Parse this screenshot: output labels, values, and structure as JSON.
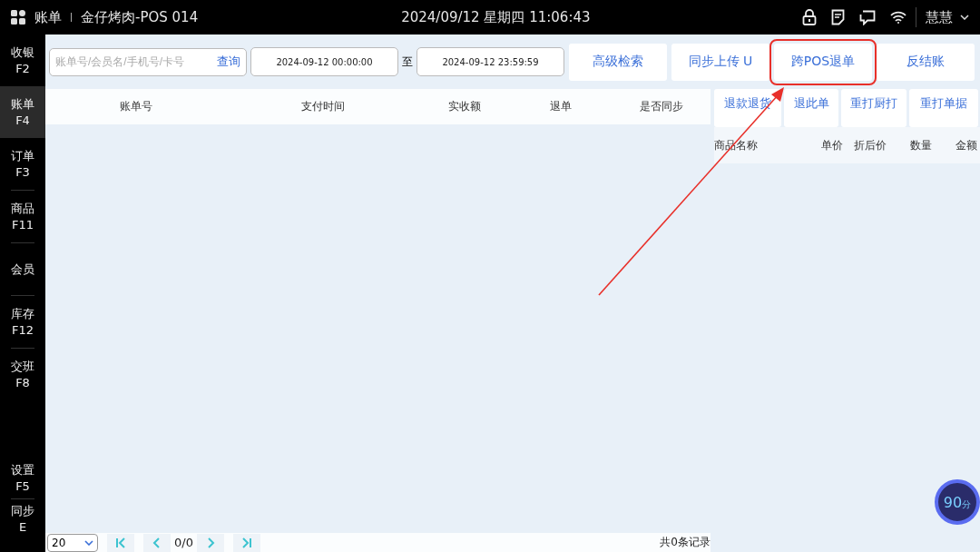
{
  "top_bar": {
    "section": "账单",
    "store": "金仔烤肉-POS 014",
    "datetime": "2024/09/12 星期四 11:06:43",
    "user": "慧慧"
  },
  "sidebar": {
    "items": [
      {
        "label": "收银",
        "key": "F2",
        "selected": false
      },
      {
        "label": "账单",
        "key": "F4",
        "selected": true
      },
      {
        "label": "订单",
        "key": "F3",
        "selected": false
      },
      {
        "label": "商品",
        "key": "F11",
        "selected": false
      },
      {
        "label": "会员",
        "selected": false
      },
      {
        "label": "库存",
        "key": "F12",
        "selected": false
      },
      {
        "label": "交班",
        "key": "F8",
        "selected": false
      }
    ],
    "bottom_items": [
      {
        "label": "设置",
        "key": "F5",
        "selected": false
      },
      {
        "label": "同步",
        "key": "E",
        "selected": false
      }
    ]
  },
  "search": {
    "placeholder": "账单号/会员名/手机号/卡号",
    "button": "查询"
  },
  "date_range": {
    "start": "2024-09-12 00:00:00",
    "separator": "至",
    "end": "2024-09-12 23:59:59"
  },
  "toolbar_buttons": [
    {
      "label": "高级检索",
      "annotated": false
    },
    {
      "label": "同步上传 U",
      "annotated": false
    },
    {
      "label": "跨POS退单",
      "annotated": true
    },
    {
      "label": "反结账",
      "annotated": false
    }
  ],
  "table": {
    "columns": [
      "账单号",
      "支付时间",
      "实收额",
      "退单",
      "是否同步"
    ]
  },
  "detail": {
    "buttons": [
      "退款退货",
      "退此单",
      "重打厨打",
      "重打单据"
    ],
    "columns": [
      "商品名称",
      "单价",
      "折后价",
      "数量",
      "金额"
    ]
  },
  "pagination": {
    "page_size": "20",
    "page": "0/0",
    "total": "共0条记录"
  },
  "score_badge": {
    "value": "90",
    "unit": "分"
  }
}
